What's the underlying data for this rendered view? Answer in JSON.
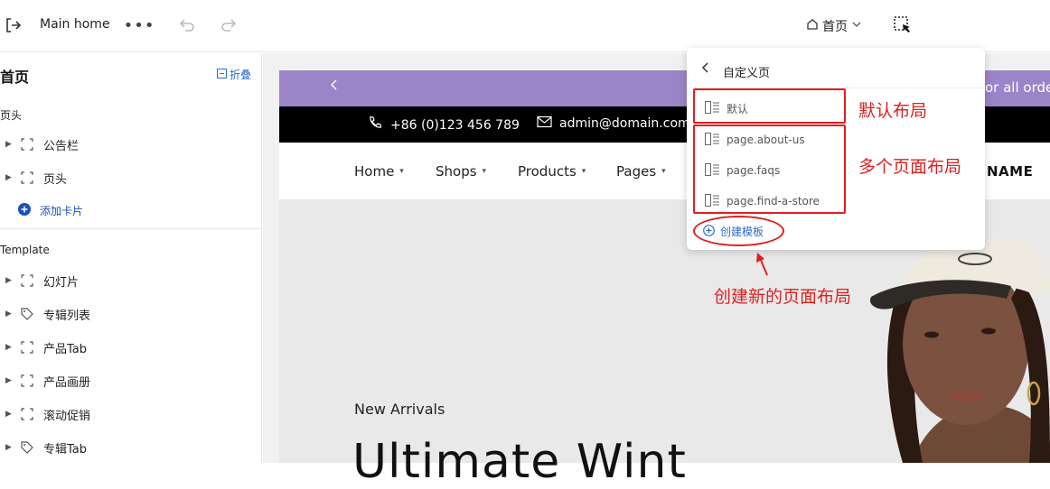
{
  "topbar": {
    "title": "Main home",
    "more": "•••",
    "page_selector": "首页"
  },
  "sidebar": {
    "title": "首页",
    "collapse_label": "折叠",
    "header_section": "页头",
    "header_items": [
      {
        "label": "公告栏",
        "icon": "section-icon"
      },
      {
        "label": "页头",
        "icon": "section-icon"
      }
    ],
    "add_card": "添加卡片",
    "template_section": "Template",
    "template_items": [
      {
        "label": "幻灯片",
        "icon": "section-icon"
      },
      {
        "label": "专辑列表",
        "icon": "tag-icon"
      },
      {
        "label": "产品Tab",
        "icon": "section-icon"
      },
      {
        "label": "产品画册",
        "icon": "section-icon"
      },
      {
        "label": "滚动促销",
        "icon": "section-icon"
      },
      {
        "label": "专辑Tab",
        "icon": "tag-icon"
      }
    ]
  },
  "preview": {
    "promo_text": "or all orders",
    "phone": "+86 (0)123 456 789",
    "email": "admin@domain.com",
    "nav": [
      "Home",
      "Shops",
      "Products",
      "Pages"
    ],
    "brand": "NAME",
    "hero_subtitle": "New Arrivals",
    "hero_title": "Ultimate Wint"
  },
  "popover": {
    "title": "自定义页",
    "items": [
      "默认",
      "page.about-us",
      "page.faqs",
      "page.find-a-store"
    ],
    "create": "创建模板"
  },
  "annotations": {
    "default_layout": "默认布局",
    "multi_layout": "多个页面布局",
    "create_new": "创建新的页面布局"
  },
  "colors": {
    "promo_bar": "#9b84c7",
    "annotation_red": "#e01f1f",
    "link_blue": "#2a6ccf"
  }
}
